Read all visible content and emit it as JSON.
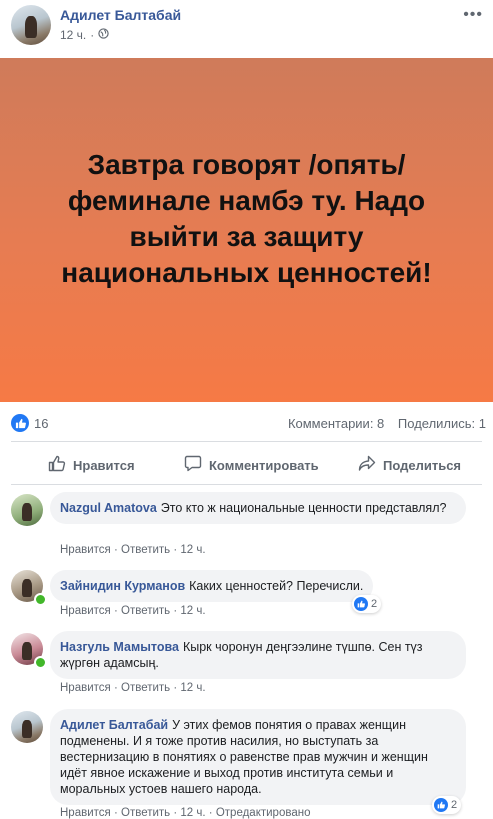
{
  "post": {
    "author": "Адилет Балтабай",
    "time": "12 ч.",
    "privacy_icon": "globe-icon",
    "text": "Завтра говорят /опять/ феминале намбэ ту. Надо выйти за защиту национальных ценностей!",
    "background_colors": [
      "#cf7b5a",
      "#f67a45"
    ]
  },
  "stats": {
    "likes": "16",
    "comments": "Комментарии: 8",
    "shares": "Поделились: 1"
  },
  "actions": {
    "like": "Нравится",
    "comment": "Комментировать",
    "share": "Поделиться"
  },
  "comments": [
    {
      "author": "Nazgul Amatova",
      "text": "Это кто ж национальные ценности представлял?",
      "like": "Нравится",
      "reply": "Ответить",
      "time": "12 ч."
    },
    {
      "author": "Зайнидин Курманов",
      "text": "Каких ценностей? Перечисли.",
      "like": "Нравится",
      "reply": "Ответить",
      "time": "12 ч.",
      "reactions": "2"
    },
    {
      "author": "Назгуль Мамытова",
      "text": "Кырк чоронун деңгээлине түшпө. Сен түз жүргөн адамсың.",
      "like": "Нравится",
      "reply": "Ответить",
      "time": "12 ч."
    },
    {
      "author": "Адилет Балтабай",
      "text": "У этих фемов понятия о правах женщин подменены. И я тоже против насилия, но выступать за вестернизацию в понятиях о равенстве прав мужчин и женщин идёт явное искажение и выход против института семьи и моральных устоев нашего народа.",
      "like": "Нравится",
      "reply": "Ответить",
      "time": "12 ч.",
      "edited": "Отредактировано",
      "reactions": "2"
    }
  ],
  "separator": "·",
  "colors": {
    "name_link": "#385898",
    "meta_text": "#606770",
    "like_blue": "#2078f4",
    "bubble_bg": "#f2f3f5",
    "online": "#42b72a"
  }
}
